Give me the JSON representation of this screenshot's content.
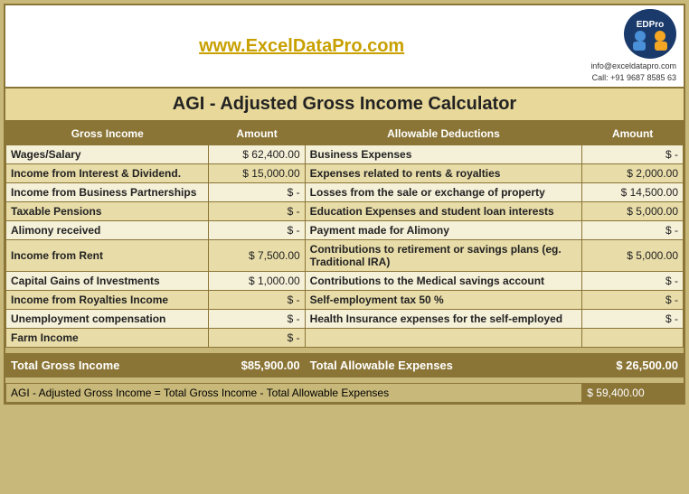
{
  "header": {
    "url": "www.ExcelDataPro.com",
    "contact_email": "info@exceldatapro.com",
    "contact_phone": "Call: +91 9687 8585 63",
    "main_title": "AGI - Adjusted Gross Income Calculator"
  },
  "table": {
    "gross_income_header": "Gross Income",
    "amount_header_1": "Amount",
    "deductions_header": "Allowable Deductions",
    "amount_header_2": "Amount",
    "rows": [
      {
        "gross_label": "Wages/Salary",
        "gross_amount": "$ 62,400.00",
        "deduct_label": "Business Expenses",
        "deduct_amount": "$  -"
      },
      {
        "gross_label": "Income from Interest & Dividend.",
        "gross_amount": "$ 15,000.00",
        "deduct_label": "Expenses related to rents & royalties",
        "deduct_amount": "$  2,000.00"
      },
      {
        "gross_label": "Income from Business Partnerships",
        "gross_amount": "$  -",
        "deduct_label": "Losses from the sale or exchange of property",
        "deduct_amount": "$ 14,500.00"
      },
      {
        "gross_label": "Taxable Pensions",
        "gross_amount": "$  -",
        "deduct_label": "Education Expenses and student loan interests",
        "deduct_amount": "$  5,000.00"
      },
      {
        "gross_label": "Alimony received",
        "gross_amount": "$  -",
        "deduct_label": "Payment made for Alimony",
        "deduct_amount": "$  -"
      },
      {
        "gross_label": "Income from Rent",
        "gross_amount": "$  7,500.00",
        "deduct_label": "Contributions to retirement or savings plans (eg. Traditional IRA)",
        "deduct_amount": "$  5,000.00"
      },
      {
        "gross_label": "Capital Gains of Investments",
        "gross_amount": "$  1,000.00",
        "deduct_label": "Contributions to the Medical savings account",
        "deduct_amount": "$  -"
      },
      {
        "gross_label": "Income from Royalties Income",
        "gross_amount": "$  -",
        "deduct_label": "Self-employment tax 50 %",
        "deduct_amount": "$  -"
      },
      {
        "gross_label": "Unemployment compensation",
        "gross_amount": "$  -",
        "deduct_label": "Health Insurance expenses for the self-employed",
        "deduct_amount": "$  -"
      },
      {
        "gross_label": "Farm Income",
        "gross_amount": "$  -",
        "deduct_label": "",
        "deduct_amount": ""
      }
    ],
    "total_gross_label": "Total Gross Income",
    "total_gross_amount": "$85,900.00",
    "total_deduct_label": "Total Allowable Expenses",
    "total_deduct_amount": "$ 26,500.00",
    "agi_formula": "AGI - Adjusted Gross Income = Total Gross Income - Total Allowable Expenses",
    "agi_result": "$ 59,400.00"
  }
}
